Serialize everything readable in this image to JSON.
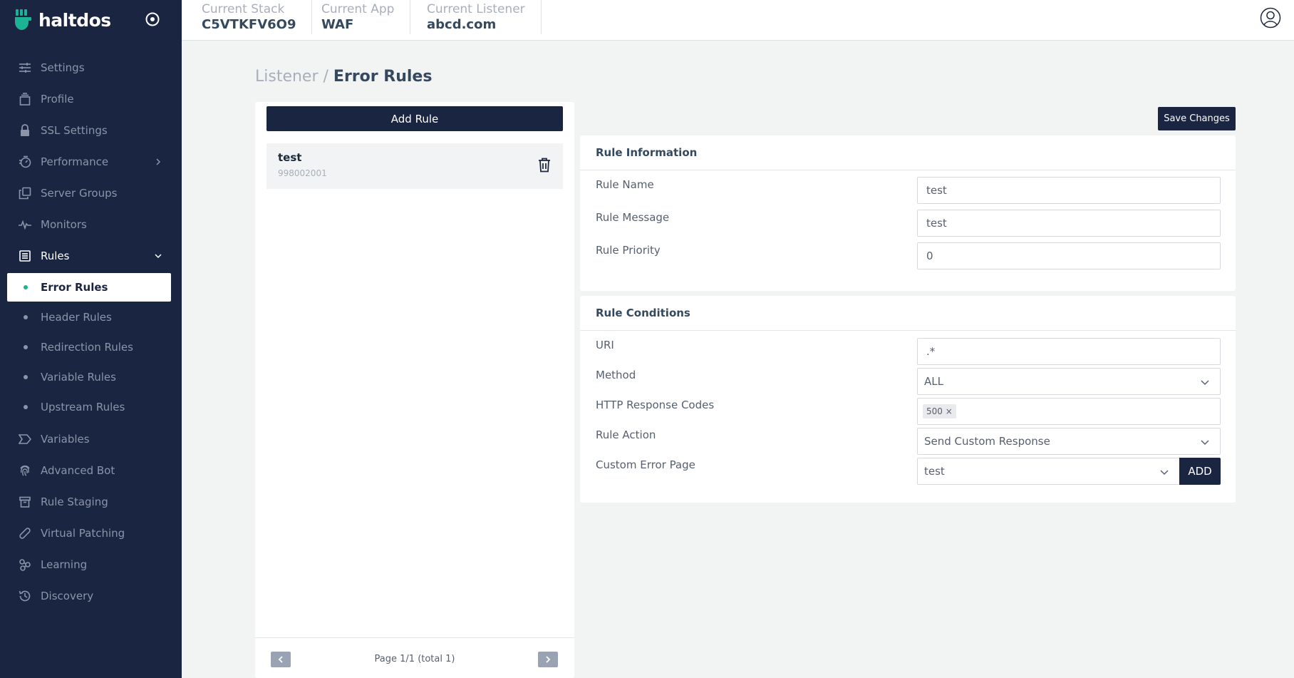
{
  "brand": {
    "name": "haltdos"
  },
  "sidebar": {
    "items": [
      {
        "label": "Settings",
        "icon": "sliders-icon"
      },
      {
        "label": "Profile",
        "icon": "profile-icon"
      },
      {
        "label": "SSL Settings",
        "icon": "lock-icon"
      },
      {
        "label": "Performance",
        "icon": "performance-icon"
      },
      {
        "label": "Server Groups",
        "icon": "server-groups-icon"
      },
      {
        "label": "Monitors",
        "icon": "pulse-icon"
      },
      {
        "label": "Rules",
        "icon": "rules-icon"
      },
      {
        "label": "Variables",
        "icon": "variables-icon"
      },
      {
        "label": "Advanced Bot",
        "icon": "fingerprint-icon"
      },
      {
        "label": "Rule Staging",
        "icon": "archive-icon"
      },
      {
        "label": "Virtual Patching",
        "icon": "bandage-icon"
      },
      {
        "label": "Learning",
        "icon": "learning-icon"
      },
      {
        "label": "Discovery",
        "icon": "history-icon"
      }
    ],
    "rules_sub": [
      {
        "label": "Error Rules",
        "active": true
      },
      {
        "label": "Header Rules"
      },
      {
        "label": "Redirection Rules"
      },
      {
        "label": "Variable Rules"
      },
      {
        "label": "Upstream Rules"
      }
    ]
  },
  "topbar": {
    "stack_label": "Current Stack",
    "stack_value": "C5VTKFV6O9",
    "app_label": "Current App",
    "app_value": "WAF",
    "listener_label": "Current Listener",
    "listener_value": "abcd.com"
  },
  "breadcrumb": {
    "parent": "Listener",
    "separator": " / ",
    "current": "Error Rules"
  },
  "rule_list": {
    "add_label": "Add Rule",
    "items": [
      {
        "name": "test",
        "id": "998002001"
      }
    ],
    "pager_text": "Page 1/1 (total 1)",
    "prev": "‹",
    "next": "›"
  },
  "save_label": "Save Changes",
  "rule_info": {
    "title": "Rule Information",
    "name_label": "Rule Name",
    "name_value": "test",
    "message_label": "Rule Message",
    "message_value": "test",
    "priority_label": "Rule Priority",
    "priority_value": "0"
  },
  "rule_conditions": {
    "title": "Rule Conditions",
    "uri_label": "URI",
    "uri_value": ".*",
    "method_label": "Method",
    "method_value": "ALL",
    "codes_label": "HTTP Response Codes",
    "codes_tags": [
      "500 ×"
    ],
    "action_label": "Rule Action",
    "action_value": "Send Custom Response",
    "error_page_label": "Custom Error Page",
    "error_page_value": "test",
    "add_label": "ADD"
  },
  "colors": {
    "sidebar_bg": "#1a2542",
    "accent": "#1bb394",
    "page_bg": "#f2f3f3"
  }
}
